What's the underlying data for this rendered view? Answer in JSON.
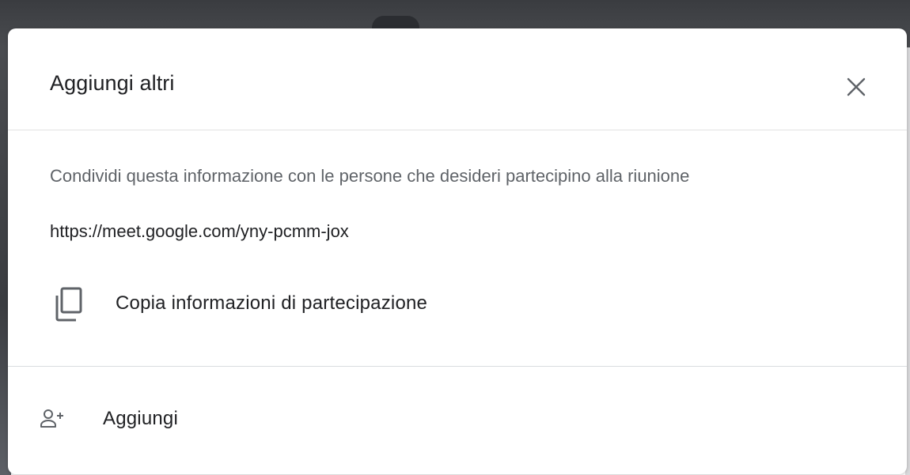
{
  "dialog": {
    "title": "Aggiungi altri",
    "close_icon": "close-icon",
    "description": "Condividi questa informazione con le persone che desideri partecipino alla riunione",
    "meeting_link": "https://meet.google.com/yny-pcmm-jox",
    "copy_action": {
      "icon": "copy-icon",
      "label": "Copia informazioni di partecipazione"
    },
    "add_action": {
      "icon": "person-add-icon",
      "label": "Aggiungi"
    }
  },
  "colors": {
    "text_primary": "#202124",
    "text_secondary": "#5f6368",
    "divider": "#dadce0",
    "backdrop": "#3a3c40"
  }
}
